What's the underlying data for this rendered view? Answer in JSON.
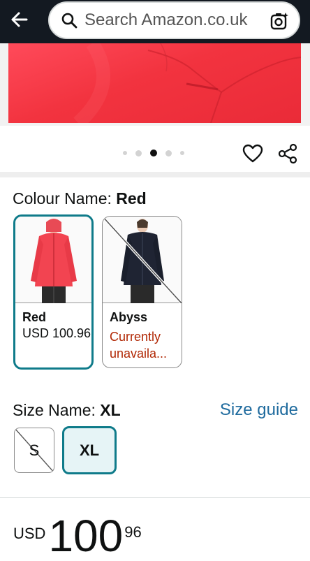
{
  "header": {
    "search_placeholder": "Search Amazon.co.uk"
  },
  "icons": {
    "back": "back-arrow-icon",
    "search": "search-icon",
    "camera": "camera-search-icon",
    "heart": "heart-icon",
    "share": "share-icon"
  },
  "carousel": {
    "total_dots": 5,
    "active_index": 2
  },
  "colour": {
    "label": "Colour Name: ",
    "selected": "Red",
    "options": [
      {
        "name": "Red",
        "price": "USD 100.96"
      },
      {
        "name": "Abyss",
        "status": "Currently unavaila..."
      }
    ]
  },
  "size": {
    "label": "Size Name: ",
    "selected": "XL",
    "guide_link": "Size guide",
    "options": [
      "S",
      "XL"
    ]
  },
  "price": {
    "currency": "USD",
    "whole": "100",
    "fraction": "96"
  },
  "colors": {
    "header_bg": "#131921",
    "accent_teal": "#0f7b8a",
    "unavailable_red": "#b12704",
    "link_blue": "#1f6b9e"
  }
}
